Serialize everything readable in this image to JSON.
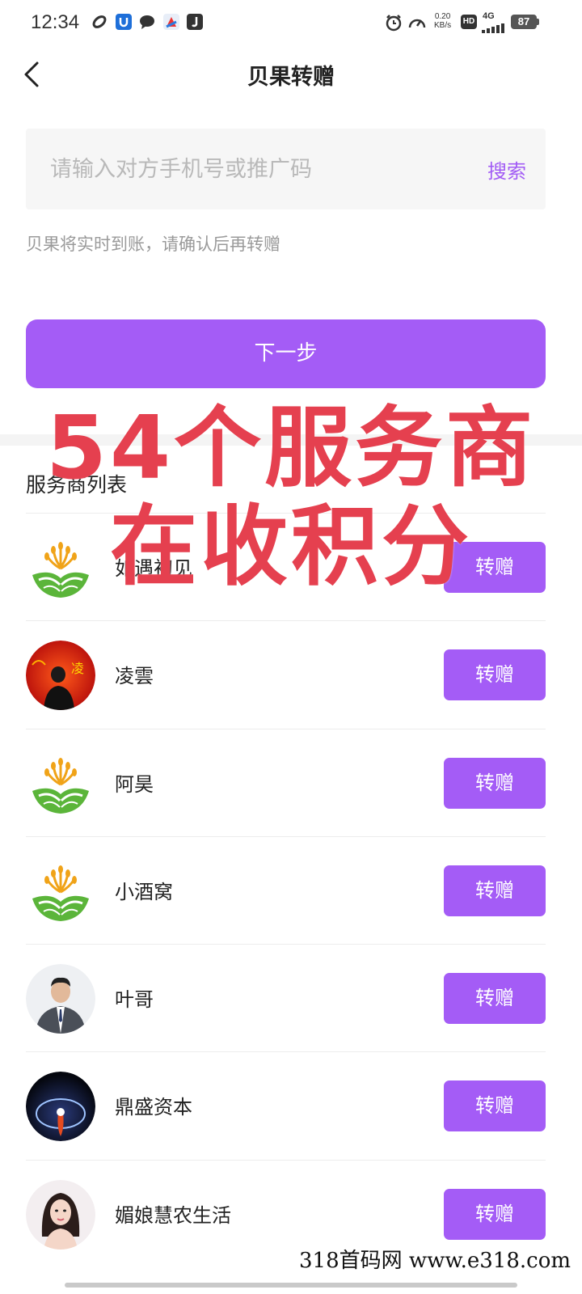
{
  "status_bar": {
    "time": "12:34",
    "net_speed_value": "0.20",
    "net_speed_unit": "KB/s",
    "hd": "HD",
    "network": "4G",
    "battery": "87"
  },
  "header": {
    "title": "贝果转赠"
  },
  "search": {
    "placeholder": "请输入对方手机号或推广码",
    "button": "搜索"
  },
  "hint": "贝果将实时到账，请确认后再转赠",
  "next_button": "下一步",
  "list_title": "服务商列表",
  "providers": [
    {
      "name": "如遇初见",
      "avatar": "wheat-logo",
      "button": "转赠"
    },
    {
      "name": "凌雲",
      "avatar": "red-photo",
      "button": "转赠"
    },
    {
      "name": "阿昊",
      "avatar": "wheat-logo",
      "button": "转赠"
    },
    {
      "name": "小酒窝",
      "avatar": "wheat-logo",
      "button": "转赠"
    },
    {
      "name": "叶哥",
      "avatar": "man-in-suit-photo",
      "button": "转赠"
    },
    {
      "name": "鼎盛资本",
      "avatar": "planet-photo",
      "button": "转赠"
    },
    {
      "name": "媚娘慧农生活",
      "avatar": "woman-photo",
      "button": "转赠"
    }
  ],
  "overlay": {
    "line1": "54个服务商",
    "line2": "在收积分"
  },
  "watermark": "318首码网 www.e318.com",
  "colors": {
    "accent": "#a45cf6",
    "overlay_red": "#e5404f"
  }
}
